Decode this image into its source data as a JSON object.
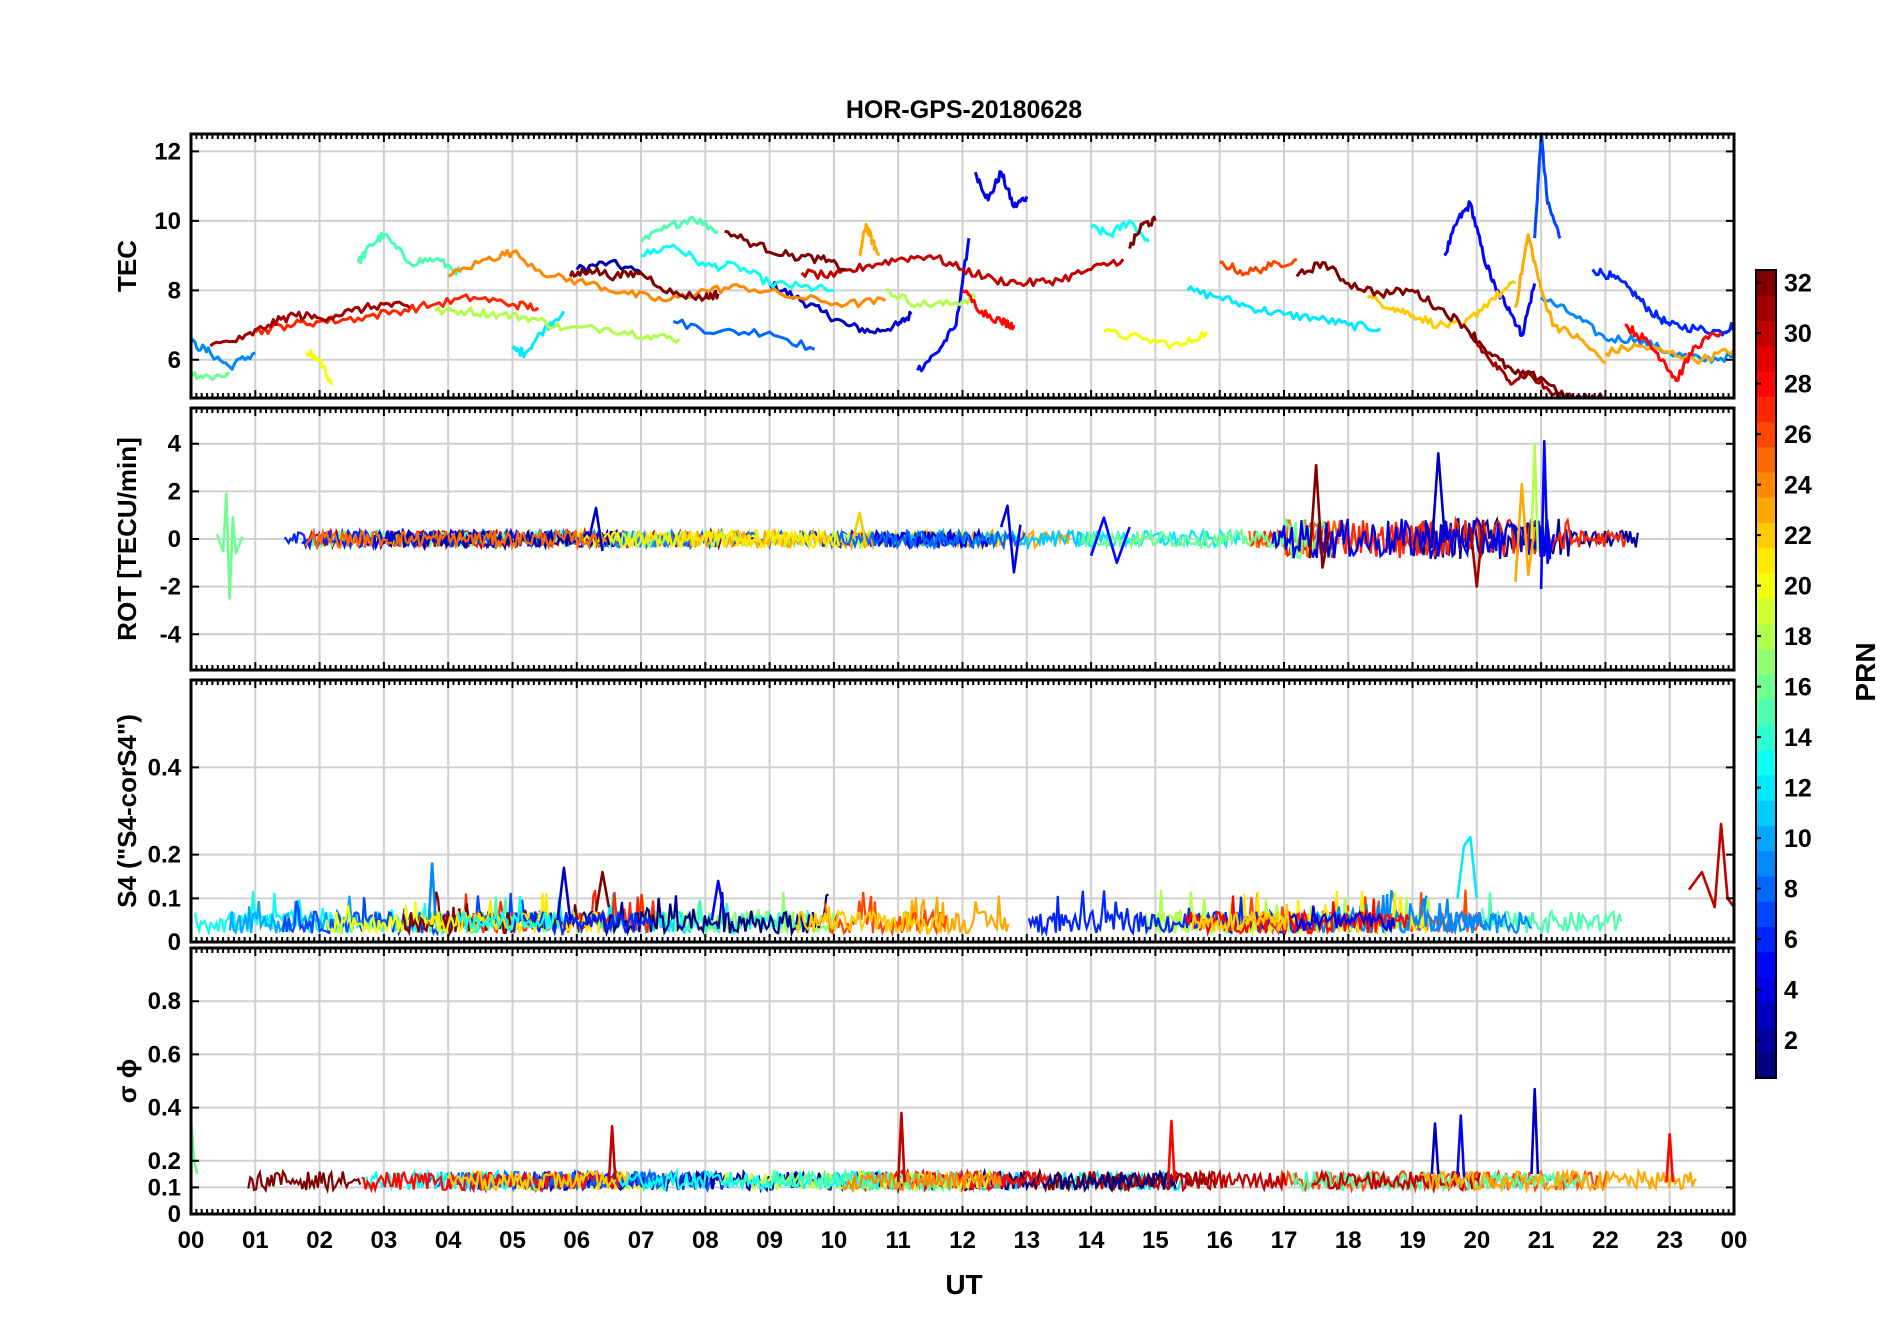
{
  "figure": {
    "title": "HOR-GPS-20180628",
    "xlabel": "UT",
    "colorbar_label": "PRN",
    "colorbar_ticks": [
      "2",
      "4",
      "6",
      "8",
      "10",
      "12",
      "14",
      "16",
      "18",
      "20",
      "22",
      "24",
      "26",
      "28",
      "30",
      "32"
    ]
  },
  "chart_data": [
    {
      "type": "line",
      "panel": "TEC",
      "ylabel": "TEC",
      "xlim": [
        0,
        24
      ],
      "ylim": [
        4.9,
        12.5
      ],
      "yticks": [
        6,
        8,
        10,
        12
      ],
      "ytick_labels": [
        "6",
        "8",
        "10",
        "12"
      ],
      "xtick_labels": [
        "00",
        "01",
        "02",
        "03",
        "04",
        "05",
        "06",
        "07",
        "08",
        "09",
        "10",
        "11",
        "12",
        "13",
        "14",
        "15",
        "16",
        "17",
        "18",
        "19",
        "20",
        "21",
        "22",
        "23",
        "00"
      ],
      "grid": true,
      "series": [
        {
          "prn": 2,
          "x": [
            6.0,
            6.5,
            7.0
          ],
          "y": [
            8.6,
            8.8,
            8.5
          ]
        },
        {
          "prn": 3,
          "x": [
            9.0,
            9.4,
            9.8,
            10.2,
            10.6,
            11.0,
            11.2
          ],
          "y": [
            8.2,
            7.8,
            7.4,
            7.0,
            6.8,
            7.0,
            7.3
          ]
        },
        {
          "prn": 4,
          "x": [
            12.2,
            12.4,
            12.6,
            12.8,
            13.0
          ],
          "y": [
            11.4,
            10.6,
            11.4,
            10.4,
            10.7
          ]
        },
        {
          "prn": 5,
          "x": [
            11.3,
            11.6,
            11.9,
            12.1
          ],
          "y": [
            5.7,
            6.2,
            7.0,
            9.5
          ]
        },
        {
          "prn": 5,
          "x": [
            19.5,
            19.7,
            19.9,
            20.1,
            20.3,
            20.5,
            20.7,
            20.9
          ],
          "y": [
            9.0,
            10.0,
            10.5,
            9.0,
            8.0,
            7.5,
            6.7,
            8.2
          ]
        },
        {
          "prn": 7,
          "x": [
            20.9,
            21.0,
            21.1,
            21.3
          ],
          "y": [
            9.5,
            12.5,
            10.5,
            9.5
          ]
        },
        {
          "prn": 6,
          "x": [
            21.8,
            22.1,
            22.4,
            22.7,
            23.0,
            23.4,
            23.8,
            24.0
          ],
          "y": [
            8.6,
            8.4,
            8.0,
            7.4,
            7.0,
            6.9,
            6.8,
            7.0
          ]
        },
        {
          "prn": 8,
          "x": [
            7.5,
            8.2,
            9.0,
            9.7
          ],
          "y": [
            7.1,
            6.8,
            6.8,
            6.3
          ]
        },
        {
          "prn": 9,
          "x": [
            0.0,
            0.3,
            0.6,
            1.0
          ],
          "y": [
            6.5,
            6.2,
            5.8,
            6.2
          ]
        },
        {
          "prn": 9,
          "x": [
            21.0,
            21.5,
            22.0,
            22.5,
            23.0,
            23.5,
            24.0
          ],
          "y": [
            7.8,
            7.3,
            6.6,
            6.6,
            6.2,
            6.0,
            6.1
          ]
        },
        {
          "prn": 12,
          "x": [
            5.0,
            5.2,
            5.5,
            5.8
          ],
          "y": [
            6.3,
            6.2,
            6.9,
            7.4
          ]
        },
        {
          "prn": 12,
          "x": [
            15.5,
            16.0,
            16.5,
            17.0,
            17.5,
            18.0,
            18.5
          ],
          "y": [
            8.0,
            7.8,
            7.5,
            7.3,
            7.2,
            7.0,
            6.9
          ]
        },
        {
          "prn": 13,
          "x": [
            7.0,
            7.5,
            8.0,
            8.5,
            9.0,
            9.5,
            10.0
          ],
          "y": [
            9.0,
            9.3,
            8.7,
            8.7,
            8.2,
            8.1,
            8.0
          ]
        },
        {
          "prn": 13,
          "x": [
            14.0,
            14.3,
            14.6,
            14.9
          ],
          "y": [
            9.8,
            9.6,
            10.0,
            9.4
          ]
        },
        {
          "prn": 15,
          "x": [
            2.6,
            2.8,
            3.0,
            3.4,
            3.8,
            4.2
          ],
          "y": [
            8.8,
            9.3,
            9.6,
            8.8,
            8.9,
            8.5
          ]
        },
        {
          "prn": 15,
          "x": [
            7.0,
            7.4,
            7.8,
            8.2
          ],
          "y": [
            9.4,
            9.8,
            10.1,
            9.7
          ]
        },
        {
          "prn": 16,
          "x": [
            0.0,
            0.3,
            0.6
          ],
          "y": [
            5.6,
            5.5,
            5.6
          ]
        },
        {
          "prn": 18,
          "x": [
            3.8,
            4.3,
            4.8,
            5.3,
            5.8,
            6.5,
            7.1,
            7.6
          ],
          "y": [
            7.4,
            7.4,
            7.3,
            7.2,
            6.9,
            6.9,
            6.7,
            6.6
          ]
        },
        {
          "prn": 18,
          "x": [
            10.8,
            11.3,
            11.8,
            12.2
          ],
          "y": [
            8.0,
            7.6,
            7.6,
            7.8
          ]
        },
        {
          "prn": 20,
          "x": [
            1.8,
            2.0,
            2.2
          ],
          "y": [
            6.2,
            6.0,
            5.3
          ]
        },
        {
          "prn": 20,
          "x": [
            14.2,
            14.8,
            15.4,
            15.8
          ],
          "y": [
            6.8,
            6.6,
            6.4,
            6.8
          ]
        },
        {
          "prn": 22,
          "x": [
            18.3,
            18.7,
            19.0,
            19.4,
            19.8,
            20.2,
            20.6
          ],
          "y": [
            7.8,
            7.5,
            7.3,
            7.0,
            7.0,
            7.7,
            8.2
          ]
        },
        {
          "prn": 23,
          "x": [
            10.4,
            10.5,
            10.6,
            10.7
          ],
          "y": [
            9.0,
            9.9,
            9.4,
            9.0
          ]
        },
        {
          "prn": 23,
          "x": [
            20.6,
            20.8,
            21.0,
            21.2,
            21.6,
            22.0
          ],
          "y": [
            7.5,
            9.6,
            8.0,
            7.0,
            6.6,
            5.9
          ]
        },
        {
          "prn": 23,
          "x": [
            22.0,
            22.5,
            23.0,
            23.5,
            24.0
          ],
          "y": [
            6.2,
            6.4,
            6.2,
            6.0,
            6.3
          ]
        },
        {
          "prn": 24,
          "x": [
            4.0,
            4.6,
            5.0,
            5.6,
            6.2,
            6.8,
            7.4,
            8.0,
            8.6,
            9.4,
            10.2,
            10.8
          ],
          "y": [
            8.4,
            8.9,
            9.1,
            8.4,
            8.2,
            7.9,
            7.7,
            8.0,
            8.1,
            7.8,
            7.6,
            7.7
          ]
        },
        {
          "prn": 26,
          "x": [
            16.0,
            16.4,
            16.8,
            17.2
          ],
          "y": [
            8.8,
            8.5,
            8.7,
            8.9
          ]
        },
        {
          "prn": 27,
          "x": [
            1.0,
            1.5,
            2.0,
            2.6,
            3.2,
            3.8,
            4.4,
            5.0,
            5.4
          ],
          "y": [
            6.8,
            7.0,
            7.1,
            7.2,
            7.4,
            7.6,
            7.8,
            7.6,
            7.5
          ]
        },
        {
          "prn": 28,
          "x": [
            12.0,
            12.3,
            12.6,
            12.8
          ],
          "y": [
            8.0,
            7.4,
            7.1,
            7.0
          ]
        },
        {
          "prn": 28,
          "x": [
            22.3,
            22.6,
            22.9,
            23.1,
            23.4,
            23.8
          ],
          "y": [
            7.0,
            6.6,
            6.0,
            5.4,
            6.4,
            6.8
          ]
        },
        {
          "prn": 30,
          "x": [
            9.5,
            10.0,
            10.5,
            11.0,
            11.5,
            12.0,
            12.5,
            13.0,
            13.5,
            14.0,
            14.5
          ],
          "y": [
            8.5,
            8.4,
            8.7,
            8.9,
            9.0,
            8.6,
            8.3,
            8.2,
            8.3,
            8.6,
            8.9
          ]
        },
        {
          "prn": 31,
          "x": [
            0.3,
            0.8,
            1.2,
            1.6,
            2.0,
            2.5,
            3.0,
            3.4
          ],
          "y": [
            6.4,
            6.6,
            7.0,
            7.3,
            7.2,
            7.4,
            7.6,
            7.5
          ]
        },
        {
          "prn": 31,
          "x": [
            19.9,
            20.2,
            20.5,
            20.8,
            21.2,
            21.6,
            22.0
          ],
          "y": [
            6.7,
            6.0,
            5.4,
            5.6,
            5.0,
            4.9,
            4.9
          ]
        },
        {
          "prn": 32,
          "x": [
            5.9,
            6.2,
            6.6,
            7.0,
            7.5,
            8.0,
            8.2
          ],
          "y": [
            8.4,
            8.6,
            8.4,
            8.5,
            7.9,
            7.8,
            7.9
          ]
        },
        {
          "prn": 32,
          "x": [
            8.3,
            8.8,
            9.3,
            9.8,
            10.2
          ],
          "y": [
            9.7,
            9.3,
            9.0,
            8.9,
            8.6
          ]
        },
        {
          "prn": 32,
          "x": [
            14.6,
            14.8,
            15.0
          ],
          "y": [
            9.2,
            9.9,
            10.0
          ]
        },
        {
          "prn": 32,
          "x": [
            17.2,
            17.6,
            18.0,
            18.5,
            19.0,
            19.4,
            19.8,
            20.2,
            20.6,
            21.0,
            21.4,
            21.8
          ],
          "y": [
            8.4,
            8.8,
            8.2,
            7.9,
            8.0,
            7.5,
            7.0,
            6.2,
            5.6,
            5.5,
            4.9,
            4.9
          ]
        }
      ]
    },
    {
      "type": "line",
      "panel": "ROT",
      "ylabel": "ROT [TECU/min]",
      "xlim": [
        0,
        24
      ],
      "ylim": [
        -5.5,
        5.5
      ],
      "yticks": [
        -4,
        -2,
        0,
        2,
        4
      ],
      "ytick_labels": [
        "-4",
        "-2",
        "0",
        "2",
        "4"
      ],
      "grid": true,
      "series": [
        {
          "prn": 16,
          "x": [
            0.4,
            0.5,
            0.55,
            0.6,
            0.65,
            0.7,
            0.8
          ],
          "y": [
            0.2,
            -0.5,
            1.9,
            -2.5,
            0.9,
            -0.6,
            0.1
          ]
        },
        {
          "prn": 3,
          "x": [
            6.2,
            6.3,
            6.4
          ],
          "y": [
            0.1,
            1.3,
            -0.5
          ]
        },
        {
          "prn": 22,
          "x": [
            10.3,
            10.4,
            10.5
          ],
          "y": [
            0.0,
            1.1,
            -0.3
          ]
        },
        {
          "prn": 4,
          "x": [
            12.6,
            12.7,
            12.8,
            12.9
          ],
          "y": [
            0.5,
            1.4,
            -1.4,
            0.6
          ]
        },
        {
          "prn": 5,
          "x": [
            14.0,
            14.2,
            14.4,
            14.6
          ],
          "y": [
            -0.7,
            0.9,
            -1.0,
            0.5
          ]
        },
        {
          "prn": 32,
          "x": [
            17.4,
            17.5,
            17.6,
            17.7
          ],
          "y": [
            -0.8,
            3.1,
            -1.2,
            0.3
          ]
        },
        {
          "prn": 3,
          "x": [
            19.3,
            19.4,
            19.5
          ],
          "y": [
            -0.4,
            3.6,
            0.1
          ]
        },
        {
          "prn": 31,
          "x": [
            19.9,
            20.0,
            20.1
          ],
          "y": [
            0.5,
            -2.0,
            0.8
          ]
        },
        {
          "prn": 23,
          "x": [
            20.6,
            20.7,
            20.8,
            20.9
          ],
          "y": [
            -1.8,
            2.3,
            -1.5,
            0.5
          ]
        },
        {
          "prn": 18,
          "x": [
            20.85,
            20.9,
            20.95
          ],
          "y": [
            0.0,
            4.0,
            -0.5
          ]
        },
        {
          "prn": 5,
          "x": [
            21.0,
            21.05,
            21.1,
            21.2
          ],
          "y": [
            -2.1,
            4.1,
            -1.0,
            0.2
          ]
        }
      ]
    },
    {
      "type": "line",
      "panel": "S4",
      "ylabel": "S4 (\"S4-corS4\")",
      "xlim": [
        0,
        24
      ],
      "ylim": [
        0,
        0.6
      ],
      "yticks": [
        0,
        0.1,
        0.2,
        0.4
      ],
      "ytick_labels": [
        "0",
        "0.1",
        "0.2",
        "0.4"
      ],
      "grid": true,
      "series": [
        {
          "prn": 9,
          "x": [
            3.7,
            3.75,
            3.8
          ],
          "y": [
            0.05,
            0.18,
            0.06
          ]
        },
        {
          "prn": 3,
          "x": [
            5.7,
            5.8,
            5.9
          ],
          "y": [
            0.05,
            0.17,
            0.05
          ]
        },
        {
          "prn": 32,
          "x": [
            6.3,
            6.4,
            6.5
          ],
          "y": [
            0.07,
            0.16,
            0.08
          ]
        },
        {
          "prn": 5,
          "x": [
            8.1,
            8.2,
            8.3
          ],
          "y": [
            0.05,
            0.14,
            0.06
          ]
        },
        {
          "prn": 12,
          "x": [
            19.7,
            19.8,
            19.9,
            20.0
          ],
          "y": [
            0.1,
            0.22,
            0.24,
            0.1
          ]
        },
        {
          "prn": 30,
          "x": [
            23.3,
            23.5,
            23.7,
            23.8,
            23.9,
            24.0
          ],
          "y": [
            0.12,
            0.16,
            0.08,
            0.27,
            0.1,
            0.08
          ]
        }
      ]
    },
    {
      "type": "line",
      "panel": "sigma_phi",
      "ylabel": "σ ϕ",
      "xlim": [
        0,
        24
      ],
      "ylim": [
        0,
        1.0
      ],
      "yticks": [
        0,
        0.1,
        0.2,
        0.4,
        0.6,
        0.8
      ],
      "ytick_labels": [
        "0",
        "0.1",
        "0.2",
        "0.4",
        "0.6",
        "0.8"
      ],
      "grid": true,
      "series": [
        {
          "prn": 16,
          "x": [
            0.0,
            0.05,
            0.1
          ],
          "y": [
            0.35,
            0.2,
            0.15
          ]
        },
        {
          "prn": 30,
          "x": [
            6.5,
            6.55,
            6.6
          ],
          "y": [
            0.12,
            0.33,
            0.13
          ]
        },
        {
          "prn": 30,
          "x": [
            11.0,
            11.05,
            11.1
          ],
          "y": [
            0.12,
            0.38,
            0.12
          ]
        },
        {
          "prn": 3,
          "x": [
            19.3,
            19.35,
            19.4
          ],
          "y": [
            0.15,
            0.34,
            0.15
          ]
        },
        {
          "prn": 5,
          "x": [
            19.7,
            19.75,
            19.8
          ],
          "y": [
            0.15,
            0.37,
            0.14
          ]
        },
        {
          "prn": 3,
          "x": [
            20.85,
            20.9,
            20.95
          ],
          "y": [
            0.15,
            0.47,
            0.15
          ]
        },
        {
          "prn": 28,
          "x": [
            15.2,
            15.25,
            15.3
          ],
          "y": [
            0.12,
            0.35,
            0.12
          ]
        },
        {
          "prn": 28,
          "x": [
            22.95,
            23.0,
            23.05
          ],
          "y": [
            0.12,
            0.3,
            0.12
          ]
        }
      ]
    }
  ]
}
